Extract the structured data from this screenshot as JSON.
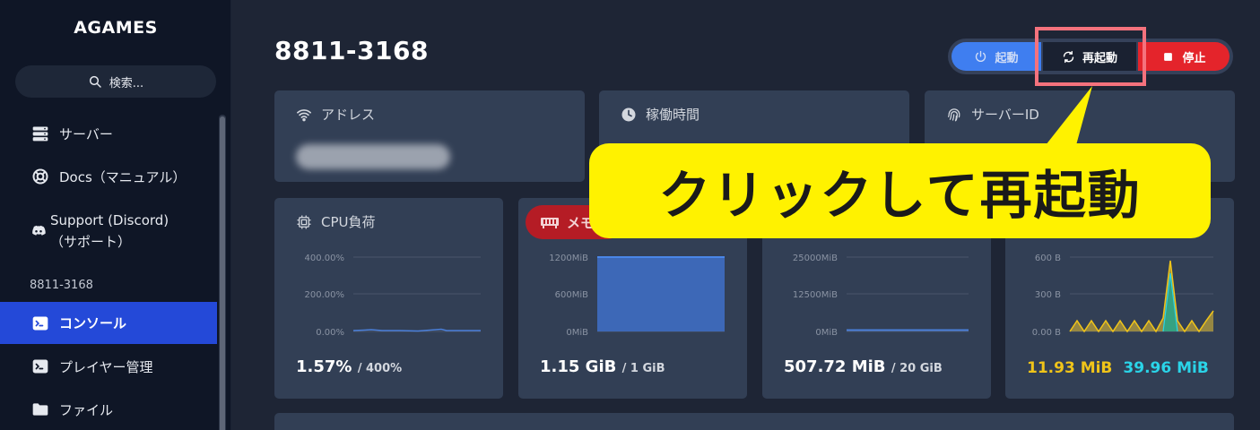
{
  "sidebar": {
    "brand": "AGAMES",
    "search_label": "検索...",
    "nav": [
      {
        "label": "サーバー",
        "icon": "server-icon"
      },
      {
        "label": "Docs（マニュアル）",
        "icon": "lifebuoy-icon"
      },
      {
        "label": "Support (Discord)",
        "label2": "（サポート）",
        "icon": "discord-icon"
      }
    ],
    "section": "8811-3168",
    "server_nav": [
      {
        "label": "コンソール",
        "icon": "terminal-icon",
        "active": true
      },
      {
        "label": "プレイヤー管理",
        "icon": "terminal-icon"
      },
      {
        "label": "ファイル",
        "icon": "folder-icon"
      }
    ]
  },
  "header": {
    "server_id": "8811-3168"
  },
  "power": {
    "start_label": "起動",
    "restart_label": "再起動",
    "stop_label": "停止"
  },
  "info_cards": [
    {
      "label": "アドレス",
      "icon": "wifi-icon"
    },
    {
      "label": "稼働時間",
      "icon": "clock-icon"
    },
    {
      "label": "サーバーID",
      "icon": "fingerprint-icon"
    }
  ],
  "stats": {
    "cpu": {
      "label": "CPU負荷",
      "value": "1.57%",
      "limit": "/ 400%",
      "ticks": [
        "400.00%",
        "200.00%",
        "0.00%"
      ]
    },
    "memory": {
      "label": "メモ",
      "value": "1.15 GiB",
      "limit": "/ 1 GiB",
      "ticks": [
        "1200MiB",
        "600MiB",
        "0MiB"
      ]
    },
    "disk": {
      "value": "507.72 MiB",
      "limit": "/ 20 GiB",
      "ticks": [
        "25000MiB",
        "12500MiB",
        "0MiB"
      ]
    },
    "network": {
      "rx": "11.93 MiB",
      "tx": "39.96 MiB",
      "ticks": [
        "600 B",
        "300 B",
        "0.00 B"
      ]
    }
  },
  "callout": {
    "text": "クリックして再起動"
  },
  "colors": {
    "accent": "#2449d8",
    "start": "#3f7ef0",
    "stop": "#e4242b",
    "callout": "#fff200",
    "rx": "#f0c419",
    "tx": "#2ad4e8"
  }
}
